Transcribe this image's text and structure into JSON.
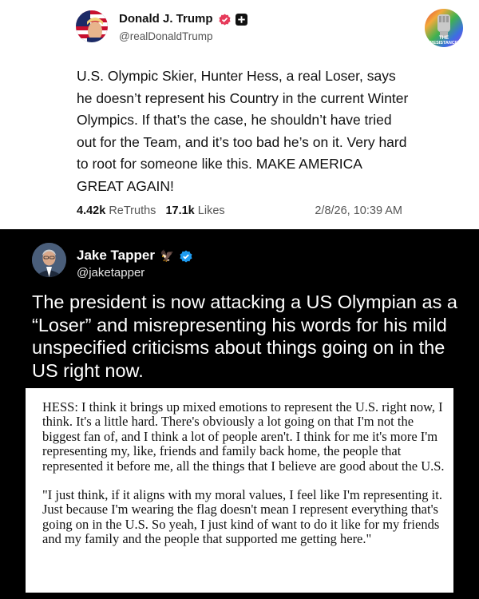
{
  "truth_post": {
    "author_name": "Donald J. Trump",
    "handle": "@realDonaldTrump",
    "text": "U.S. Olympic Skier, Hunter Hess, a real Loser, says he doesn’t represent his Country in the current Winter Olympics. If that’s the case, he shouldn’t have tried out for the Team, and it’s too bad he’s on it. Very hard to root for someone like this. MAKE AMERICA GREAT AGAIN!",
    "retruths_count": "4.42k",
    "retruths_label": "ReTruths",
    "likes_count": "17.1k",
    "likes_label": "Likes",
    "timestamp": "2/8/26, 10:39 AM",
    "verified_color": "#e63a5a"
  },
  "resistance_badge": {
    "text_line1": "THE",
    "text_line2": "RESISTANCE"
  },
  "tweet": {
    "author_name": "Jake Tapper",
    "handle": "@jaketapper",
    "name_emoji": "🦅",
    "text": "The president is now attacking a US Olympian as a “Loser” and misrepresenting his words for his mild unspecified criticisms about things going on in the US right now.",
    "verified_color": "#1d9bf0"
  },
  "quote_box": {
    "paragraph1": "HESS: I think it brings up mixed emotions to represent the U.S. right now, I think. It's a little hard. There's obviously a lot going on that I'm not the biggest fan of, and I think a lot of people aren't. I think for me it's more I'm representing my, like, friends and family back home, the people that represented it before me, all the things that I believe are good about the U.S.",
    "paragraph2": "\"I just think, if it aligns with my moral values, I feel like I'm representing it. Just because I'm wearing the flag doesn't mean I represent everything that's going on in the U.S. So yeah, I just kind of want to do it like for my friends and my family and the people that supported me getting here.\""
  }
}
